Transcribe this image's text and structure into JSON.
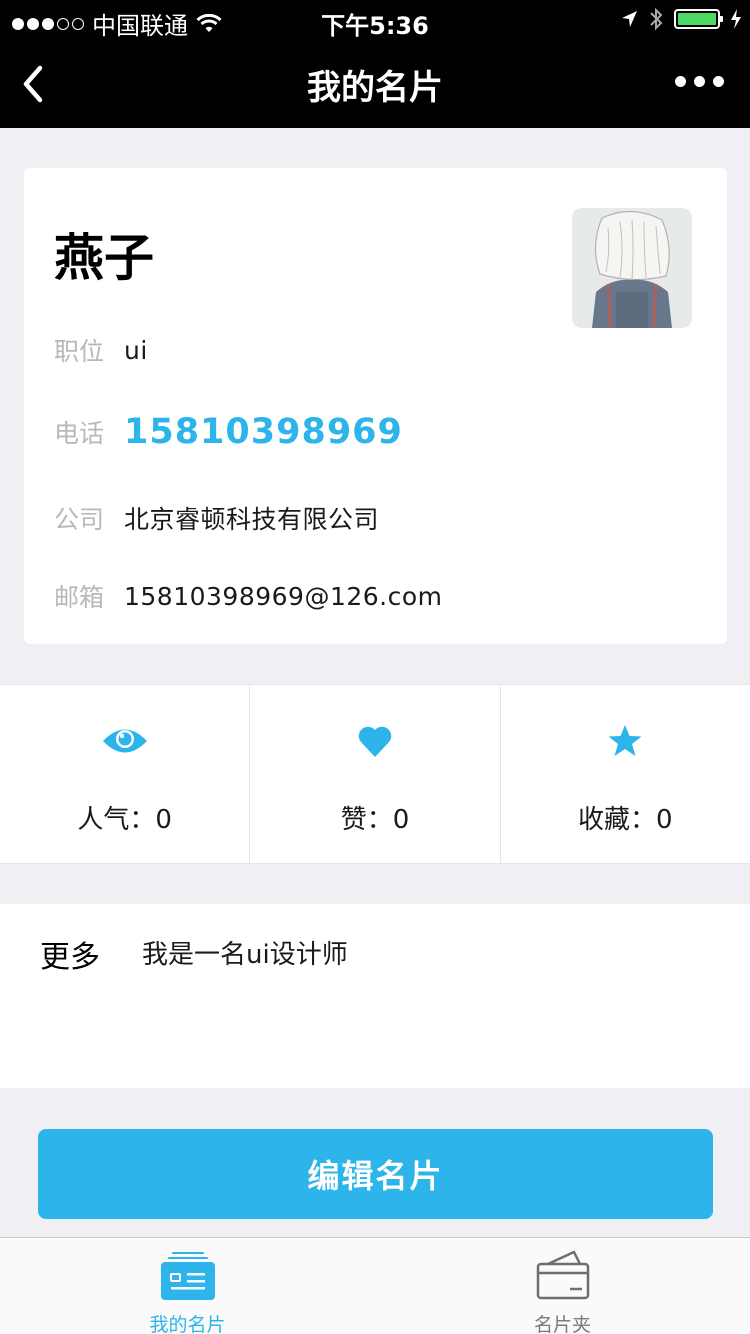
{
  "status_bar": {
    "carrier": "中国联通",
    "time": "下午5:36"
  },
  "nav": {
    "title": "我的名片",
    "back_icon": "chevron-left-icon",
    "more_icon": "more-horizontal-icon"
  },
  "profile": {
    "name": "燕子",
    "fields": [
      {
        "label": "职位",
        "value": "ui"
      },
      {
        "label": "电话",
        "value": "15810398969"
      },
      {
        "label": "公司",
        "value": "北京睿顿科技有限公司"
      },
      {
        "label": "邮箱",
        "value": "15810398969@126.com"
      }
    ]
  },
  "stats": [
    {
      "label": "人气：0",
      "icon": "eye-icon"
    },
    {
      "label": "赞：0",
      "icon": "heart-icon"
    },
    {
      "label": "收藏：0",
      "icon": "star-icon"
    }
  ],
  "more": {
    "label": "更多",
    "value": "我是一名ui设计师"
  },
  "edit_button": "编辑名片",
  "tabs": [
    {
      "label": "我的名片",
      "icon": "card-icon",
      "active": true
    },
    {
      "label": "名片夹",
      "icon": "wallet-icon",
      "active": false
    }
  ],
  "colors": {
    "accent": "#2db4ea",
    "battery": "#4cd964",
    "background": "#efeff4"
  }
}
